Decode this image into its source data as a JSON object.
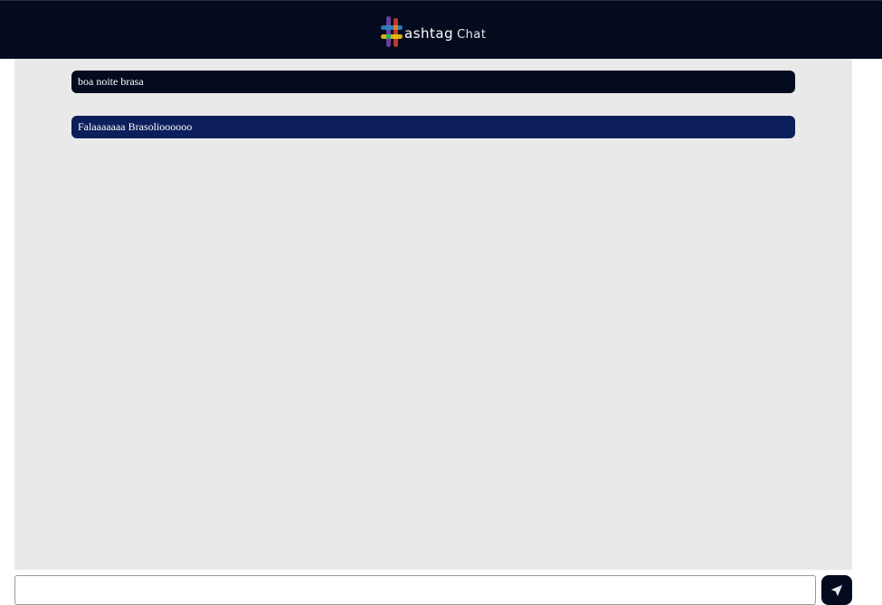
{
  "header": {
    "logo_wordmark": "ashtag",
    "logo_suffix": "Chat"
  },
  "messages": [
    {
      "text": "boa noite brasa",
      "style": "other"
    },
    {
      "text": "Falaaaaaaa Brasolioooooo",
      "style": "self"
    }
  ],
  "composer": {
    "value": "",
    "placeholder": ""
  },
  "send_button": {
    "icon": "paper-plane-icon"
  },
  "colors": {
    "header_bg": "#050b1f",
    "chat_bg": "#e9e9e9",
    "message_other": "#050b1f",
    "message_self": "#0c1f5c"
  }
}
